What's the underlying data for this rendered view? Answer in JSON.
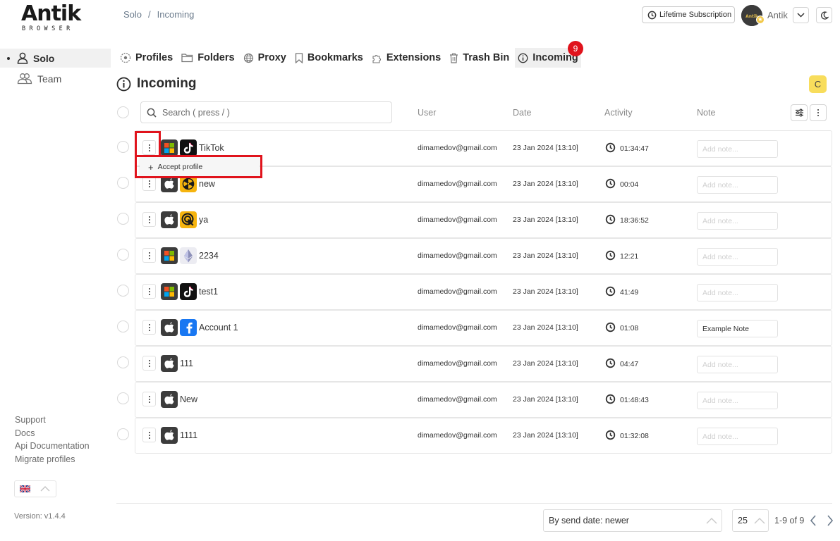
{
  "app": {
    "logo_main": "Antik",
    "logo_sub": "BROWSER"
  },
  "sidebar": {
    "items": [
      {
        "label": "Solo",
        "active": true
      },
      {
        "label": "Team",
        "active": false
      }
    ],
    "links": [
      "Support",
      "Docs",
      "Api Documentation",
      "Migrate profiles"
    ],
    "version": "Version: v1.4.4"
  },
  "header": {
    "breadcrumb": [
      "Solo",
      "/",
      "Incoming"
    ],
    "subscription_label": "Lifetime Subscription",
    "user_name": "Antik"
  },
  "tabs": [
    {
      "label": "Profiles",
      "icon": "profiles-icon"
    },
    {
      "label": "Folders",
      "icon": "folder-icon"
    },
    {
      "label": "Proxy",
      "icon": "globe-icon"
    },
    {
      "label": "Bookmarks",
      "icon": "bookmark-icon"
    },
    {
      "label": "Extensions",
      "icon": "puzzle-icon"
    },
    {
      "label": "Trash Bin",
      "icon": "trash-icon"
    },
    {
      "label": "Incoming",
      "icon": "info-icon",
      "active": true
    }
  ],
  "incoming_badge": "9",
  "page": {
    "title": "Incoming",
    "refresh_label": "C"
  },
  "search": {
    "placeholder": "Search ( press / )"
  },
  "columns": {
    "user": "User",
    "date": "Date",
    "activity": "Activity",
    "note": "Note"
  },
  "note_placeholder": "Add note...",
  "rows": [
    {
      "name": "TikTok",
      "os": "windows",
      "app": "tiktok",
      "user": "dimamedov@gmail.com",
      "date": "23 Jan 2024 [13:10]",
      "activity": "01:34:47",
      "note": ""
    },
    {
      "name": "new",
      "os": "apple",
      "app": "radiation",
      "user": "dimamedov@gmail.com",
      "date": "23 Jan 2024 [13:10]",
      "activity": "00:04",
      "note": ""
    },
    {
      "name": "ya",
      "os": "apple",
      "app": "target-cursor",
      "user": "dimamedov@gmail.com",
      "date": "23 Jan 2024 [13:10]",
      "activity": "18:36:52",
      "note": ""
    },
    {
      "name": "2234",
      "os": "windows",
      "app": "ethereum",
      "user": "dimamedov@gmail.com",
      "date": "23 Jan 2024 [13:10]",
      "activity": "12:21",
      "note": ""
    },
    {
      "name": "test1",
      "os": "windows",
      "app": "tiktok",
      "user": "dimamedov@gmail.com",
      "date": "23 Jan 2024 [13:10]",
      "activity": "41:49",
      "note": ""
    },
    {
      "name": "Account 1",
      "os": "apple",
      "app": "facebook",
      "user": "dimamedov@gmail.com",
      "date": "23 Jan 2024 [13:10]",
      "activity": "01:08",
      "note": "Example Note"
    },
    {
      "name": "111",
      "os": "apple",
      "app": "",
      "user": "dimamedov@gmail.com",
      "date": "23 Jan 2024 [13:10]",
      "activity": "04:47",
      "note": ""
    },
    {
      "name": "New",
      "os": "apple",
      "app": "",
      "user": "dimamedov@gmail.com",
      "date": "23 Jan 2024 [13:10]",
      "activity": "01:48:43",
      "note": ""
    },
    {
      "name": "1111",
      "os": "apple",
      "app": "",
      "user": "dimamedov@gmail.com",
      "date": "23 Jan 2024 [13:10]",
      "activity": "01:32:08",
      "note": ""
    }
  ],
  "context_menu": {
    "accept_label": "Accept profile"
  },
  "footer": {
    "sort_label": "By send date: newer",
    "page_size": "25",
    "page_info": "1-9 of 9"
  },
  "colors": {
    "accent_yellow": "#f8dd5c",
    "badge_red": "#e0131c",
    "highlight_red": "#e0131c"
  }
}
